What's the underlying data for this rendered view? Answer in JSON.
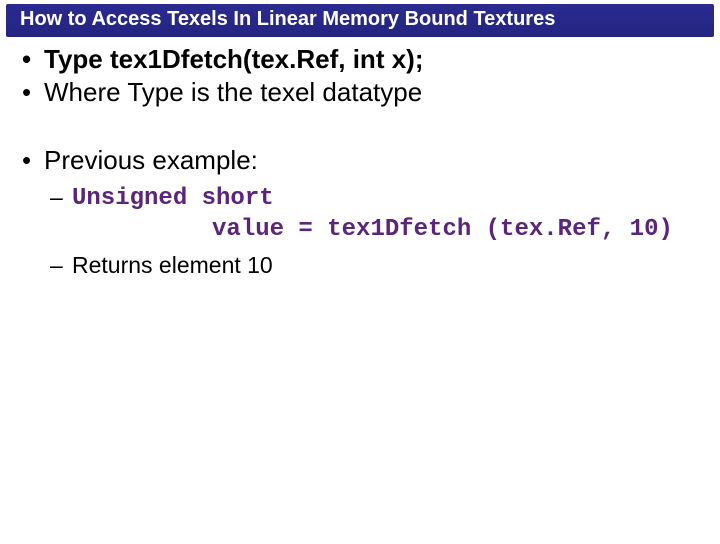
{
  "title": "How to Access Texels In Linear Memory Bound Textures",
  "bullets": {
    "b1": "Type tex1Dfetch(tex.Ref, int x);",
    "b2": "Where Type is the texel datatype",
    "b3": "Previous example:",
    "sub": {
      "code_line1": "Unsigned short",
      "code_line2": "     value = tex1Dfetch (tex.Ref, 10)",
      "returns": "Returns element 10"
    }
  }
}
